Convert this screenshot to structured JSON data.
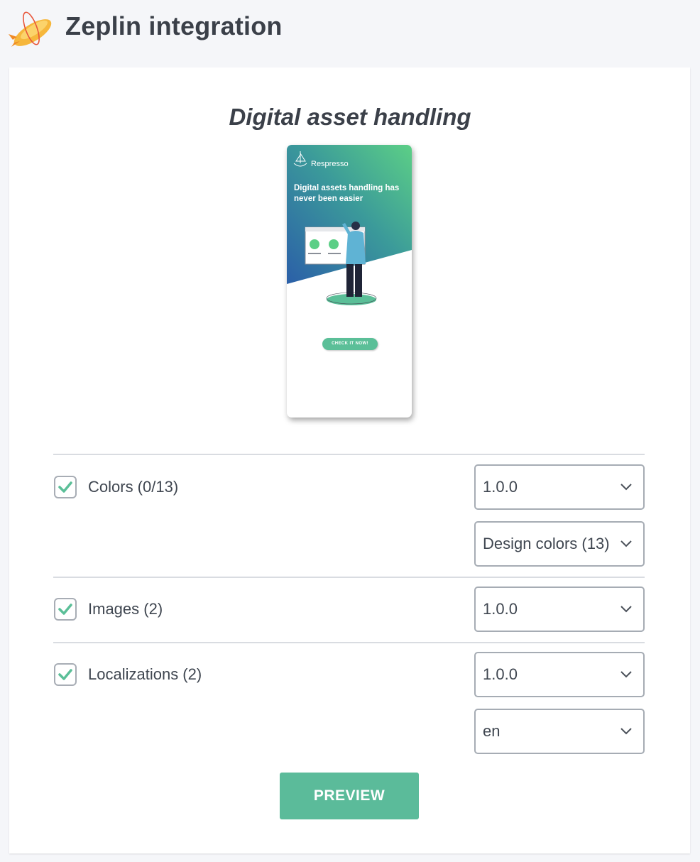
{
  "header": {
    "title": "Zeplin integration",
    "logo_icon": "zeplin-blimp-icon"
  },
  "section": {
    "title": "Digital asset handling"
  },
  "preview_image": {
    "brand": "Respresso",
    "headline": "Digital assets handling has never been easier",
    "cta": "CHECK IT NOW!"
  },
  "rows": [
    {
      "label": "Colors (0/13)",
      "checked": true,
      "selects": [
        "1.0.0",
        "Design colors (13)"
      ]
    },
    {
      "label": "Images (2)",
      "checked": true,
      "selects": [
        "1.0.0"
      ]
    },
    {
      "label": "Localizations (2)",
      "checked": true,
      "selects": [
        "1.0.0",
        "en"
      ]
    }
  ],
  "actions": {
    "preview_label": "PREVIEW"
  },
  "colors": {
    "accent": "#5bbb9a",
    "check": "#5bbf98",
    "text": "#3f4650",
    "background": "#f5f6f9"
  }
}
